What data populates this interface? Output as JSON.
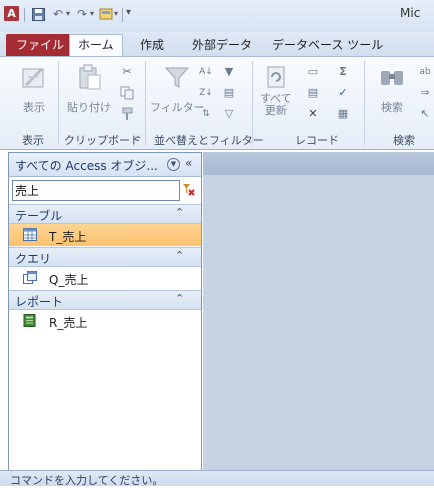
{
  "titlebar": {
    "app_icon": "A",
    "title": "Mic"
  },
  "tabs": [
    {
      "label": "ファイル"
    },
    {
      "label": "ホーム"
    },
    {
      "label": "作成"
    },
    {
      "label": "外部データ"
    },
    {
      "label": "データベース ツール"
    }
  ],
  "ribbon": {
    "view_label": "表示",
    "paste_label": "貼り付け",
    "filter_label": "フィルター",
    "refresh_label_1": "すべて",
    "refresh_label_2": "更新",
    "find_label": "検索",
    "group_labels": [
      "表示",
      "クリップボード",
      "並べ替えとフィルター",
      "レコード",
      "検索"
    ]
  },
  "nav": {
    "title": "すべての Access オブジ...",
    "search_value": "売上",
    "groups": [
      {
        "label": "テーブル",
        "items": [
          {
            "label": "T_売上",
            "icon": "table-icon",
            "selected": true
          }
        ]
      },
      {
        "label": "クエリ",
        "items": [
          {
            "label": "Q_売上",
            "icon": "query-icon",
            "selected": false
          }
        ]
      },
      {
        "label": "レポート",
        "items": [
          {
            "label": "R_売上",
            "icon": "report-icon",
            "selected": false
          }
        ]
      }
    ]
  },
  "status": {
    "text": "コマンドを入力してください。"
  },
  "colors": {
    "file_tab": "#a42c35",
    "selected_row": "#fbc26f",
    "content_bg": "#c6d3e5"
  }
}
